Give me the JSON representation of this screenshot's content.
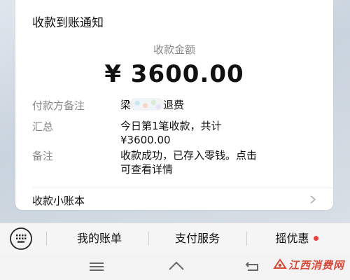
{
  "notification": {
    "title": "收款到账通知",
    "amount_label": "收款金额",
    "amount": "¥ 3600.00",
    "rows": [
      {
        "label": "付款方备注",
        "value_prefix": "梁",
        "value_suffix": "退费"
      },
      {
        "label": "汇总",
        "value_line1": "今日第1笔收款，共计",
        "value_line2": "¥3600.00"
      },
      {
        "label": "备注",
        "value_line1": "收款成功，已存入零钱。点击",
        "value_line2": "可查看详情"
      }
    ],
    "ledger_label": "收款小账本"
  },
  "bottom_menu": {
    "items": [
      {
        "label": "我的账单"
      },
      {
        "label": "支付服务"
      },
      {
        "label": "摇优惠",
        "has_dot": true
      }
    ]
  },
  "watermark": {
    "text": "江西消费网"
  },
  "colors": {
    "accent_red": "#e64340",
    "watermark_red": "#d64a3a"
  },
  "icons": [
    "keyboard-icon",
    "chevron-right-icon",
    "menu-nav-icon",
    "home-nav-icon",
    "back-nav-icon"
  ]
}
